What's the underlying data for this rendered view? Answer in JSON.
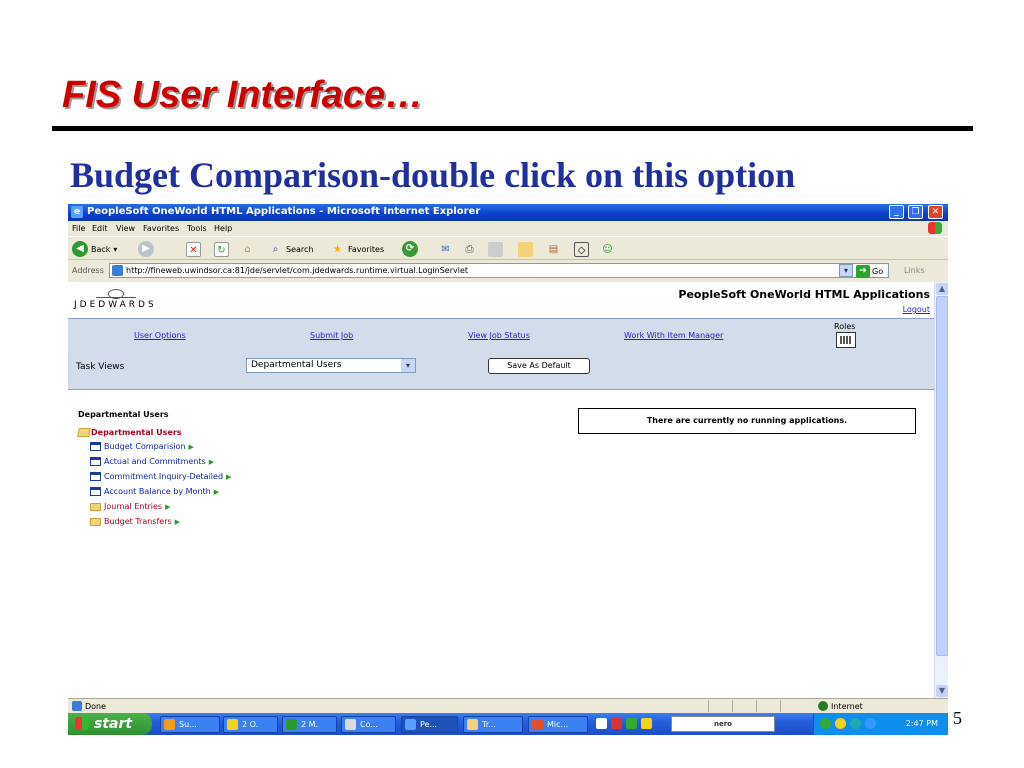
{
  "slide": {
    "title": "FIS User Interface…",
    "subtitle": "Budget Comparison-double click on this option",
    "page_number": "5"
  },
  "browser": {
    "window_title": "PeopleSoft OneWorld HTML Applications - Microsoft Internet Explorer",
    "menu": [
      "File",
      "Edit",
      "View",
      "Favorites",
      "Tools",
      "Help"
    ],
    "toolbar": {
      "back": "Back",
      "search": "Search",
      "favorites": "Favorites"
    },
    "address_label": "Address",
    "address_value": "http://fineweb.uwindsor.ca:81/jde/servlet/com.jdedwards.runtime.virtual.LoginServlet",
    "go_label": "Go",
    "links_label": "Links",
    "status_text": "Done",
    "zone_text": "Internet"
  },
  "app": {
    "logo_text": "JDEDWARDS",
    "heading": "PeopleSoft OneWorld HTML Applications",
    "logout": "Logout",
    "nav": [
      "User Options",
      "Submit Job",
      "View Job Status",
      "Work With Item Manager"
    ],
    "roles_label": "Roles",
    "task_views_label": "Task Views",
    "task_views_selected": "Departmental Users",
    "save_default": "Save As Default",
    "section_heading": "Departmental Users",
    "running_message": "There are currently no running applications.",
    "tree_root": "Departmental Users",
    "tree_items": [
      {
        "label": "Budget Comparision",
        "type": "app"
      },
      {
        "label": "Actual and Commitments",
        "type": "app"
      },
      {
        "label": "Commitment Inquiry-Detailed",
        "type": "app"
      },
      {
        "label": "Account Balance by Month",
        "type": "app"
      },
      {
        "label": "Journal Entries",
        "type": "folder"
      },
      {
        "label": "Budget Transfers",
        "type": "folder"
      }
    ]
  },
  "taskbar": {
    "start": "start",
    "tasks": [
      "Su...",
      "2 O.",
      "2 M.",
      "Co...",
      "Pe...",
      "Tr...",
      "Mic..."
    ],
    "nero": "nero",
    "clock": "2:47 PM"
  }
}
